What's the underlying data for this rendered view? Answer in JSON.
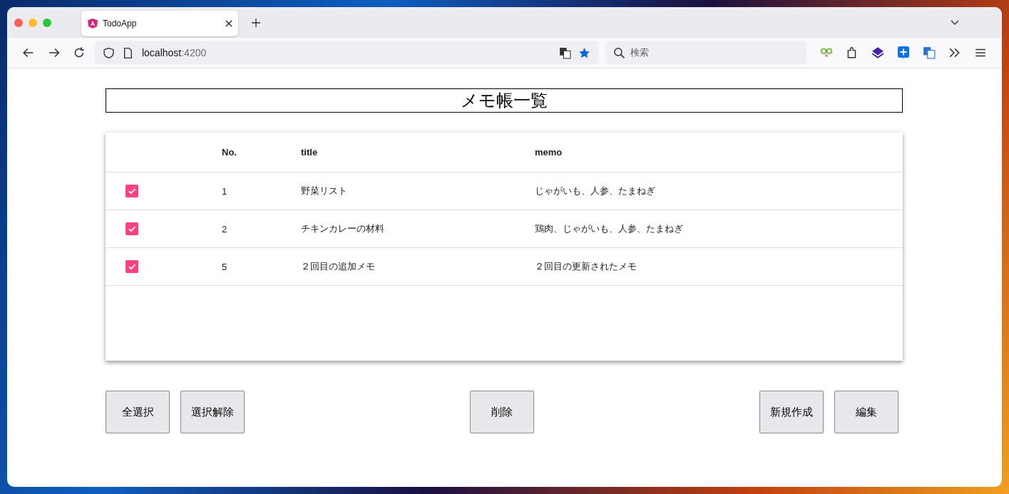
{
  "browser": {
    "tab": {
      "title": "TodoApp",
      "selected": true
    },
    "url_host": "localhost",
    "url_port": ":4200",
    "search": {
      "placeholder": "検索"
    }
  },
  "page": {
    "heading": "メモ帳一覧",
    "table": {
      "columns": [
        "No.",
        "title",
        "memo"
      ],
      "rows": [
        {
          "checked": true,
          "no": "1",
          "title": "野菜リスト",
          "memo": "じゃがいも、人参、たまねぎ"
        },
        {
          "checked": true,
          "no": "2",
          "title": "チキンカレーの材料",
          "memo": "鶏肉、じゃがいも、人参、たまねぎ"
        },
        {
          "checked": true,
          "no": "5",
          "title": "２回目の追加メモ",
          "memo": "２回目の更新されたメモ"
        }
      ]
    },
    "buttons_left": [
      "全選択",
      "選択解除"
    ],
    "button_center": "削除",
    "buttons_right": [
      "新規作成",
      "編集"
    ]
  }
}
